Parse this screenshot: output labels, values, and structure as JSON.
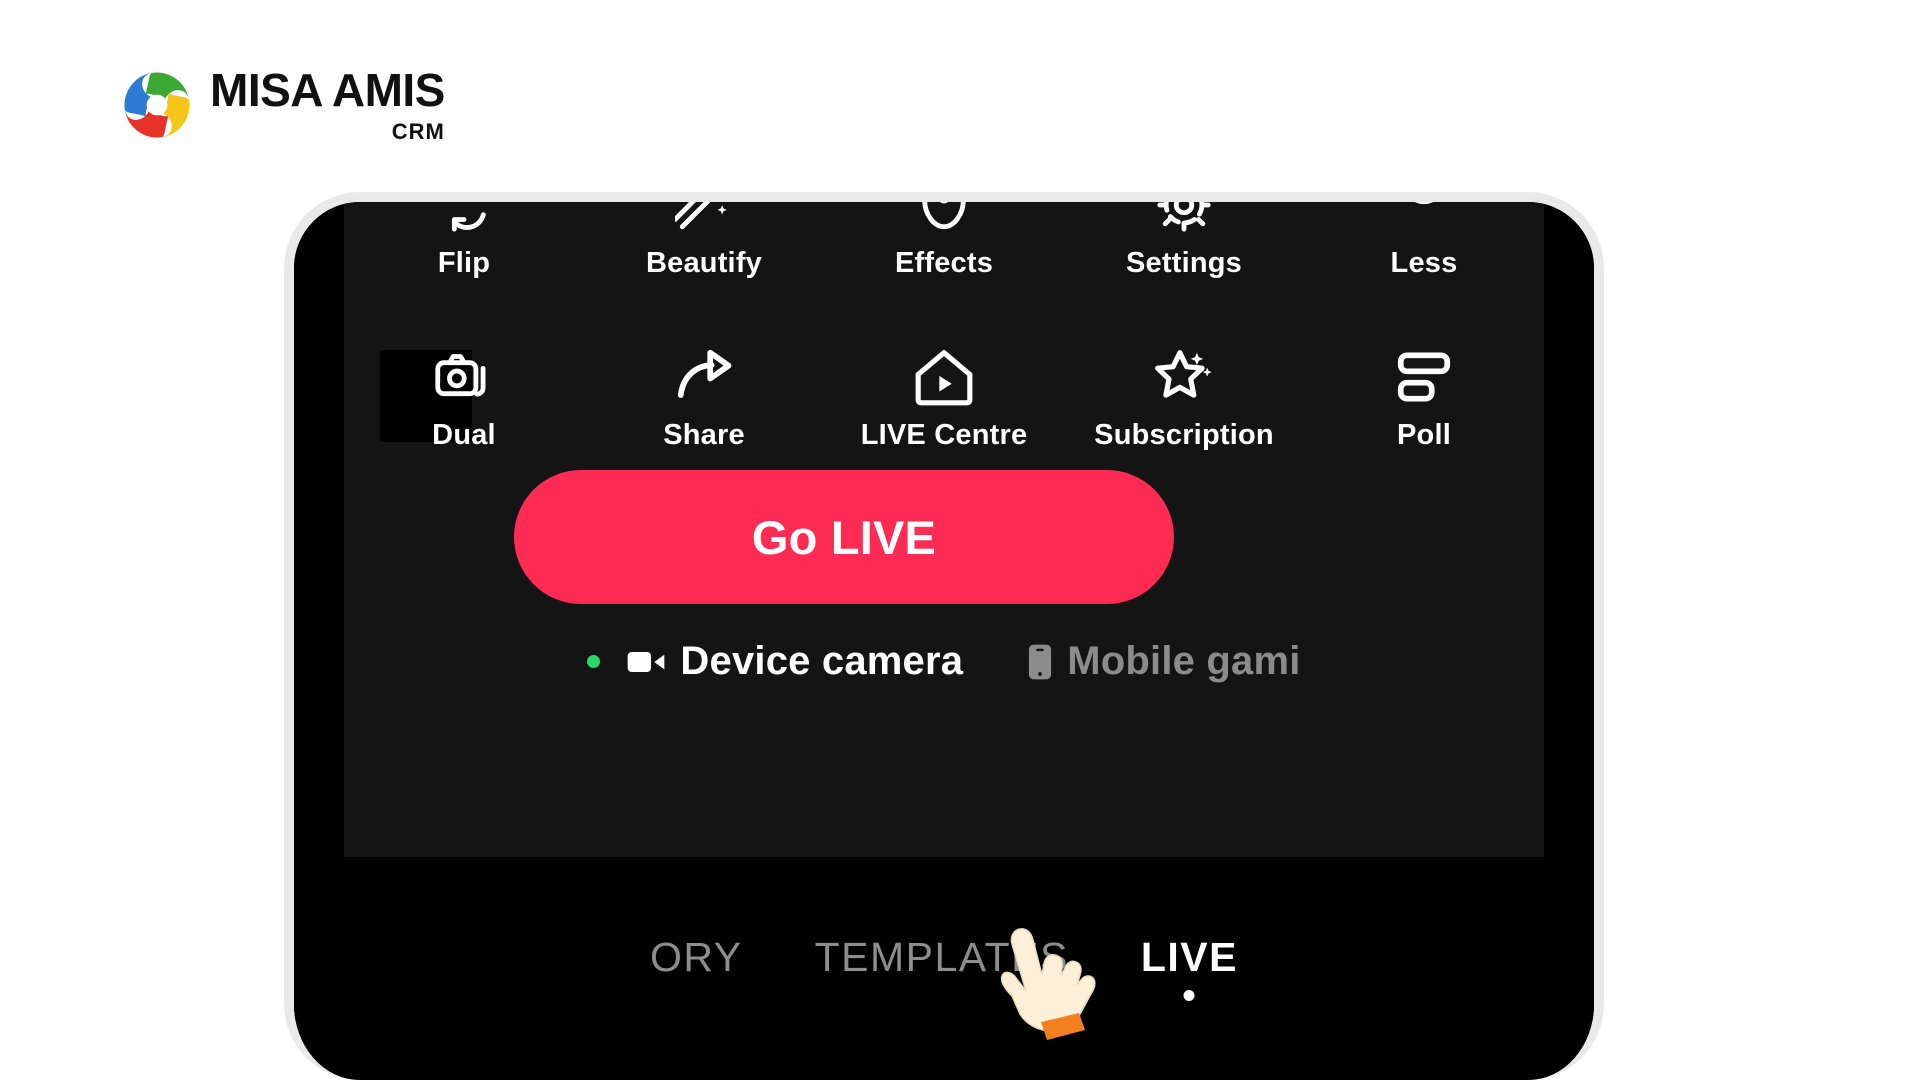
{
  "brand": {
    "name": "MISA AMIS",
    "subtitle": "CRM",
    "logo_icon": "misa-pinwheel-logo",
    "colors": {
      "green": "#3AAA35",
      "blue": "#2E7BD4",
      "red": "#E63329",
      "yellow": "#F5C518",
      "text": "#111111"
    }
  },
  "phone": {
    "frame_color": "#e9e9e9",
    "screen_background": "#000000",
    "panel_background": "#141414"
  },
  "live": {
    "tool_rows": [
      {
        "row": 1,
        "items": [
          {
            "label": "Flip",
            "icon": "flip-camera-icon"
          },
          {
            "label": "Beautify",
            "icon": "beautify-wand-icon"
          },
          {
            "label": "Effects",
            "icon": "effects-face-icon"
          },
          {
            "label": "Settings",
            "icon": "settings-gear-icon"
          },
          {
            "label": "Less",
            "icon": "less-chevron-icon"
          }
        ]
      },
      {
        "row": 2,
        "items": [
          {
            "label": "Dual",
            "icon": "dual-camera-icon"
          },
          {
            "label": "Share",
            "icon": "share-arrow-icon"
          },
          {
            "label": "LIVE Centre",
            "icon": "live-centre-home-icon"
          },
          {
            "label": "Subscription",
            "icon": "subscription-star-icon"
          },
          {
            "label": "Poll",
            "icon": "poll-bars-icon"
          }
        ]
      }
    ],
    "go_live": {
      "label": "Go LIVE",
      "color": "#fe2c55",
      "text_color": "#ffffff"
    },
    "modes": [
      {
        "label": "Device camera",
        "icon": "video-camera-icon",
        "selected": true,
        "status_dot_color": "#27d86a"
      },
      {
        "label": "Mobile gami",
        "icon": "mobile-phone-icon",
        "selected": false
      }
    ]
  },
  "tabs": {
    "items": [
      {
        "label": "ORY",
        "active": false
      },
      {
        "label": "TEMPLATES",
        "active": false
      },
      {
        "label": "LIVE",
        "active": true
      }
    ]
  },
  "cursor": {
    "icon": "pointing-hand-cursor",
    "hand_color": "#fdf0d8",
    "cuff_color": "#f28020"
  }
}
